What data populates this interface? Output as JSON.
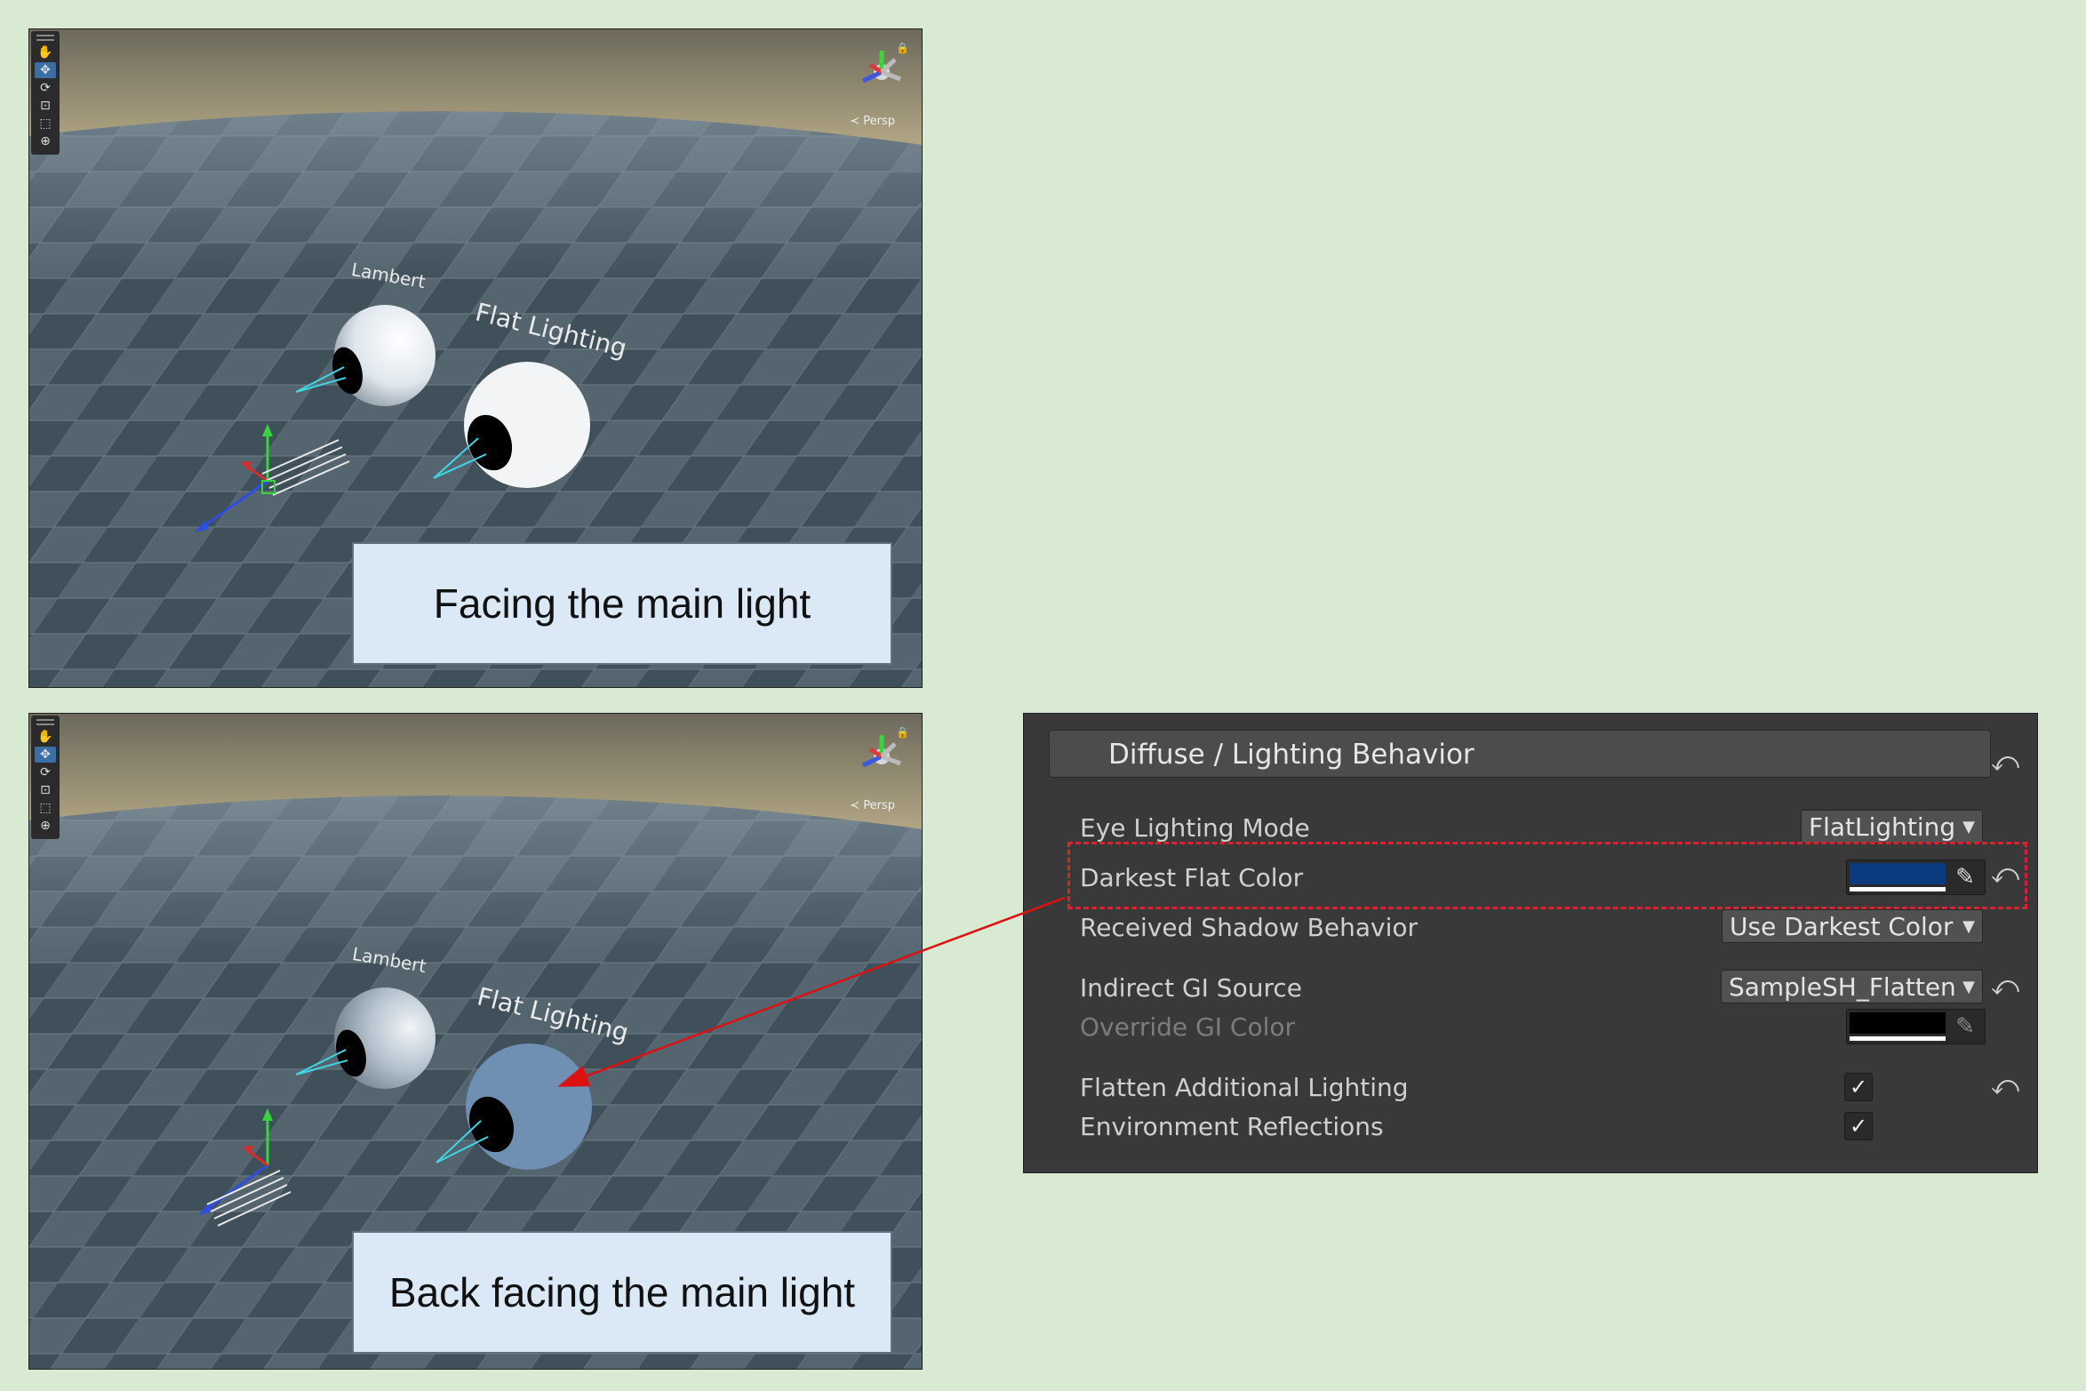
{
  "colors": {
    "background": "#d9ead3",
    "darkest_flat_color": "#0c3a7e",
    "override_gi_color": "#000000",
    "highlight": "#d9232e",
    "arrow": "#dd1111"
  },
  "viewports": [
    {
      "caption": "Facing the main light",
      "label_lambert": "Lambert",
      "label_flat": "Flat Lighting",
      "persp_label": "Persp",
      "flat_sphere_color": "#f2f4f6"
    },
    {
      "caption": "Back facing the main light",
      "label_lambert": "Lambert",
      "label_flat": "Flat Lighting",
      "persp_label": "Persp",
      "flat_sphere_color": "#6f8fb3"
    }
  ],
  "toolbar": {
    "icons": [
      "hand-icon",
      "move-icon",
      "rotate-icon",
      "scale-icon",
      "rect-icon",
      "transform-icon"
    ]
  },
  "inspector": {
    "section_title": "Diffuse / Lighting Behavior",
    "rows": {
      "eye_lighting_mode": {
        "label": "Eye Lighting Mode",
        "value": "FlatLighting"
      },
      "darkest_flat_color": {
        "label": "Darkest Flat Color"
      },
      "received_shadow": {
        "label": "Received Shadow Behavior",
        "value": "Use Darkest Color"
      },
      "indirect_gi": {
        "label": "Indirect GI Source",
        "value": "SampleSH_Flatten"
      },
      "override_gi": {
        "label": "Override GI Color"
      },
      "flatten_additional": {
        "label": "Flatten Additional Lighting",
        "checked": true
      },
      "env_reflections": {
        "label": "Environment Reflections",
        "checked": true
      }
    }
  }
}
